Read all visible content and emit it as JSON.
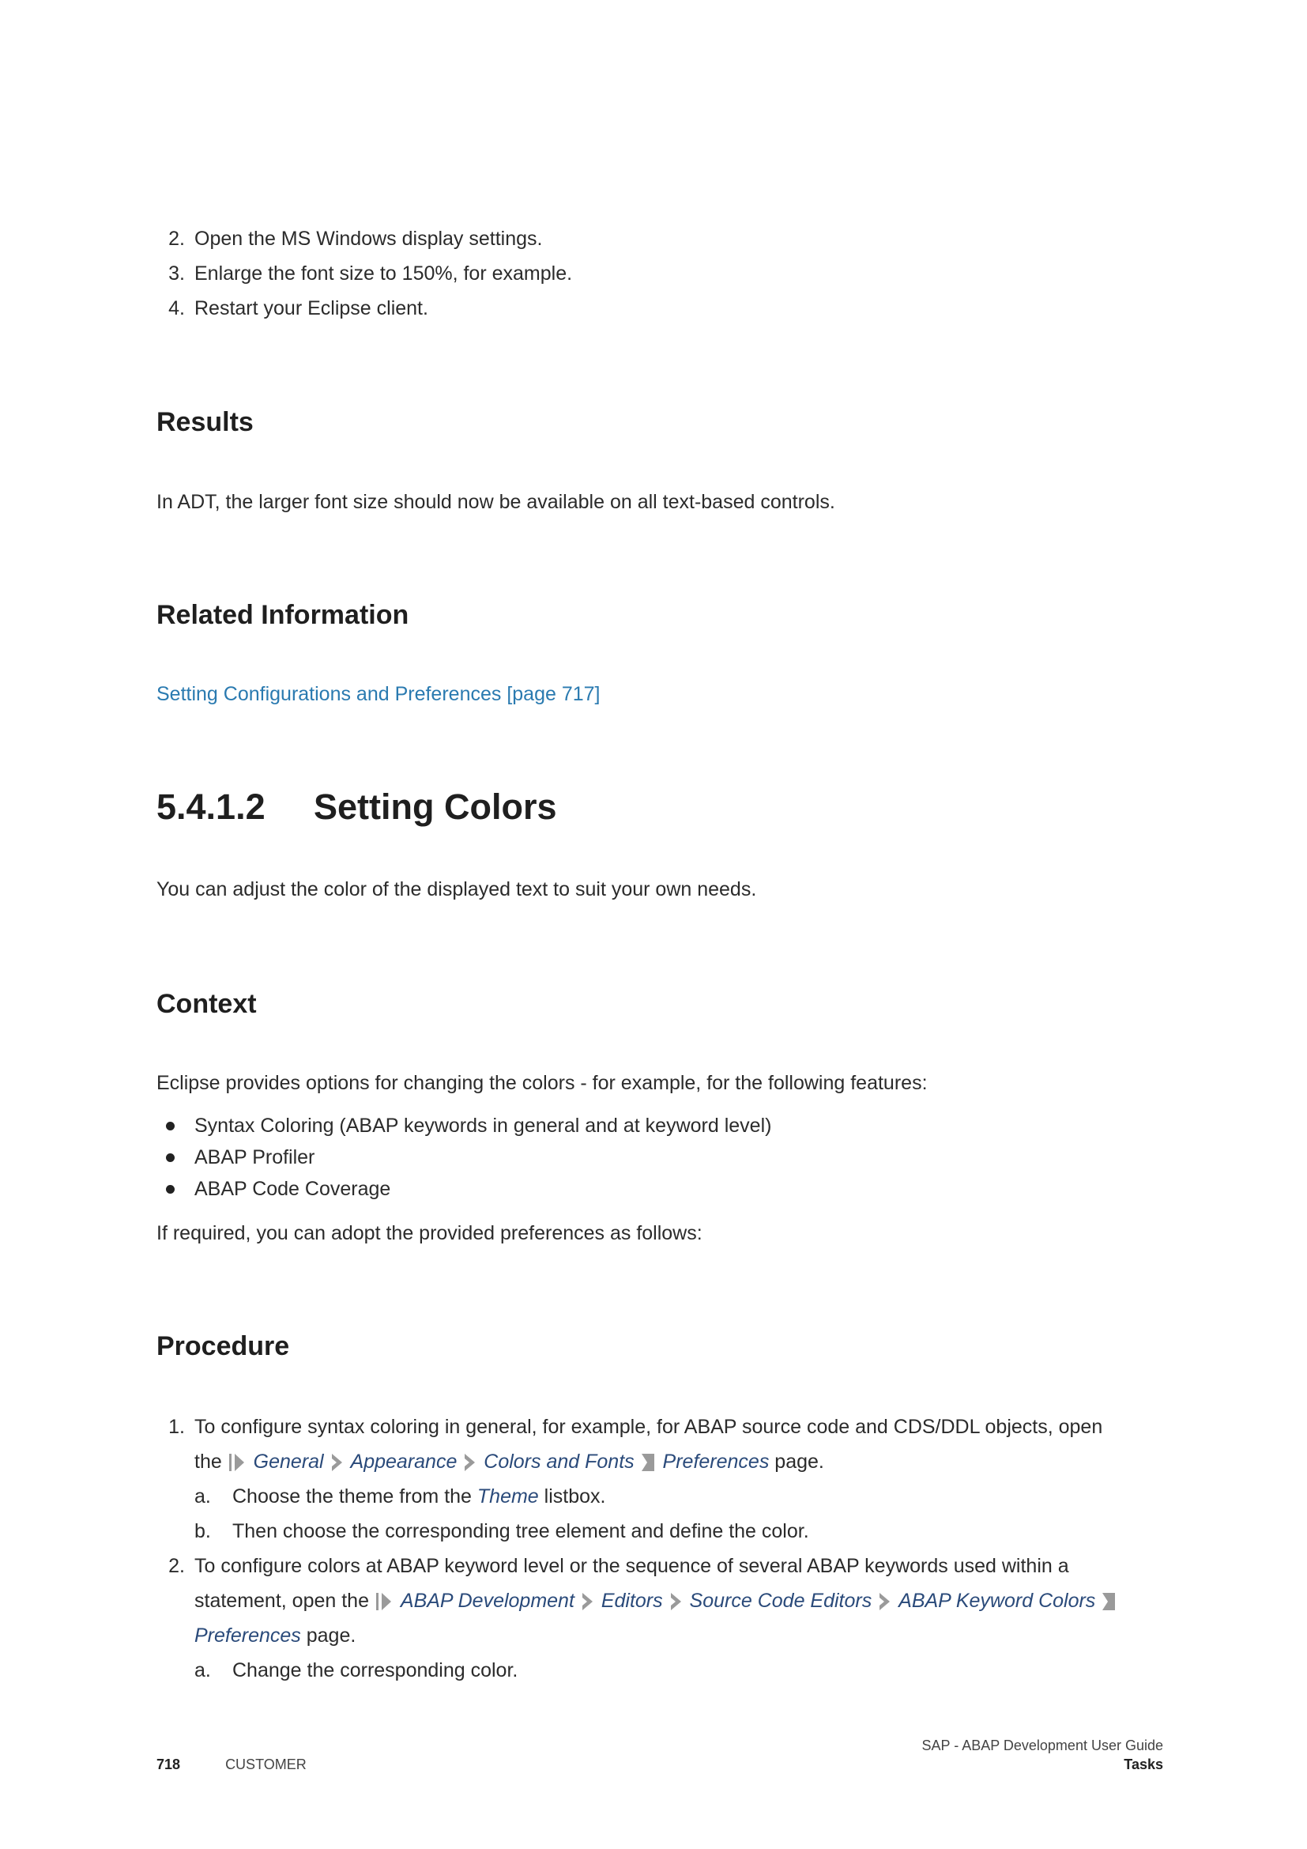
{
  "intro_steps": [
    {
      "num": "2.",
      "text": "Open the MS Windows display settings."
    },
    {
      "num": "3.",
      "text": "Enlarge the font size to 150%, for example."
    },
    {
      "num": "4.",
      "text": "Restart your Eclipse client."
    }
  ],
  "results": {
    "heading": "Results",
    "text": "In ADT, the larger font size should now be available on all text-based controls."
  },
  "related": {
    "heading": "Related Information",
    "link": "Setting Configurations and Preferences [page 717]"
  },
  "section": {
    "number": "5.4.1.2",
    "title": "Setting Colors",
    "intro": "You can adjust the color of the displayed text to suit your own needs."
  },
  "context": {
    "heading": "Context",
    "text": "Eclipse provides options for changing the colors - for example, for the following features:",
    "bullets": [
      "Syntax Coloring (ABAP keywords in general and at keyword level)",
      "ABAP Profiler",
      "ABAP Code Coverage"
    ],
    "outro": "If required, you can adopt the provided preferences as follows:"
  },
  "procedure": {
    "heading": "Procedure",
    "step1": {
      "num": "1.",
      "text_a": "To configure syntax coloring in general, for example, for ABAP source code and CDS/DDL objects, open",
      "text_b": "the",
      "path": [
        "General",
        "Appearance",
        "Colors and Fonts",
        "Preferences"
      ],
      "text_end": "page.",
      "subs": [
        {
          "num": "a.",
          "pre": "Choose the theme from the ",
          "em": "Theme",
          "post": " listbox."
        },
        {
          "num": "b.",
          "pre": "Then choose the corresponding tree element and define the color.",
          "em": "",
          "post": ""
        }
      ]
    },
    "step2": {
      "num": "2.",
      "text_a": "To configure colors at ABAP keyword level or the sequence of several ABAP keywords used within a",
      "text_b": "statement, open the",
      "path": [
        "ABAP Development",
        "Editors",
        "Source Code Editors",
        "ABAP Keyword Colors",
        "Preferences"
      ],
      "text_end": "page.",
      "subs": [
        {
          "num": "a.",
          "pre": "Change the corresponding color.",
          "em": "",
          "post": ""
        }
      ]
    }
  },
  "footer": {
    "page": "718",
    "label": "CUSTOMER",
    "doc_title": "SAP - ABAP Development User Guide",
    "section": "Tasks"
  },
  "colors": {
    "link": "#2a7ab0",
    "path_text": "#2a4a7a",
    "path_arrow": "#9a9a9a",
    "text": "#2b2b2b"
  },
  "icons": {
    "path_start": "path-start-icon",
    "path_sep": "chevron-right-icon",
    "path_end": "path-end-icon"
  }
}
